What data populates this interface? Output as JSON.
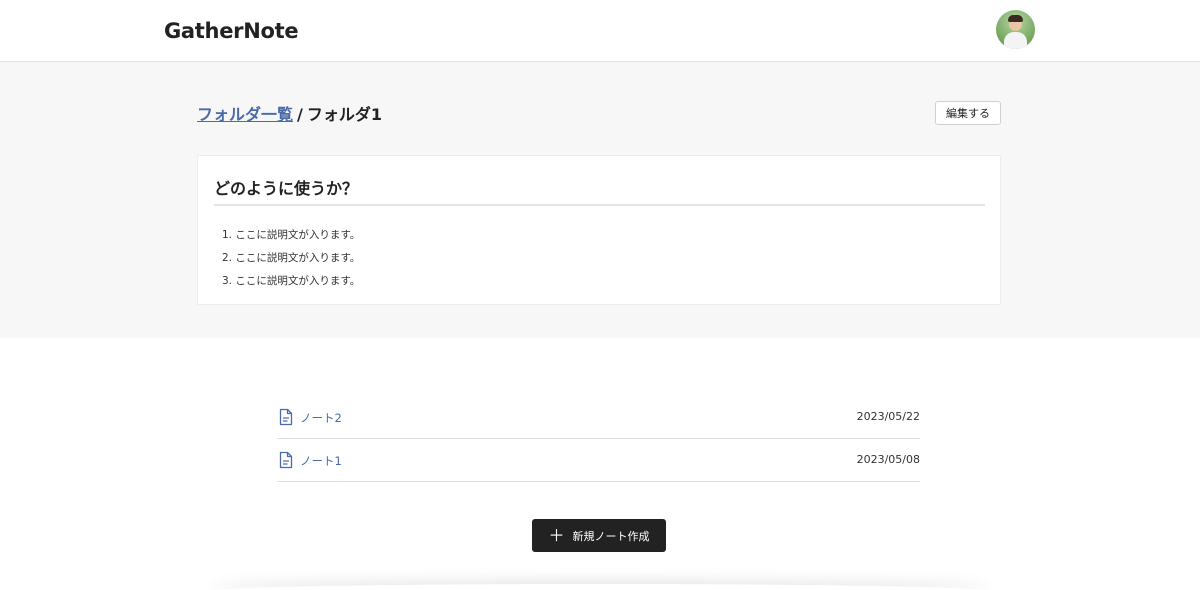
{
  "header": {
    "logo": "GatherNote"
  },
  "breadcrumb": {
    "parent_label": "フォルダ一覧",
    "separator": "/",
    "current_label": "フォルダ1"
  },
  "actions": {
    "edit_label": "編集する",
    "create_label": "新規ノート作成"
  },
  "description": {
    "title": "どのように使うか？",
    "steps": [
      "1. ここに説明文が入ります。",
      "2. ここに説明文が入ります。",
      "3. ここに説明文が入ります。"
    ]
  },
  "notes": [
    {
      "title": "ノート2",
      "date": "2023/05/22",
      "icon": "document-icon"
    },
    {
      "title": "ノート1",
      "date": "2023/05/08",
      "icon": "document-icon"
    }
  ],
  "colors": {
    "link": "#4a6aa8",
    "primary_button": "#222222",
    "hero_background": "#f7f7f7"
  }
}
